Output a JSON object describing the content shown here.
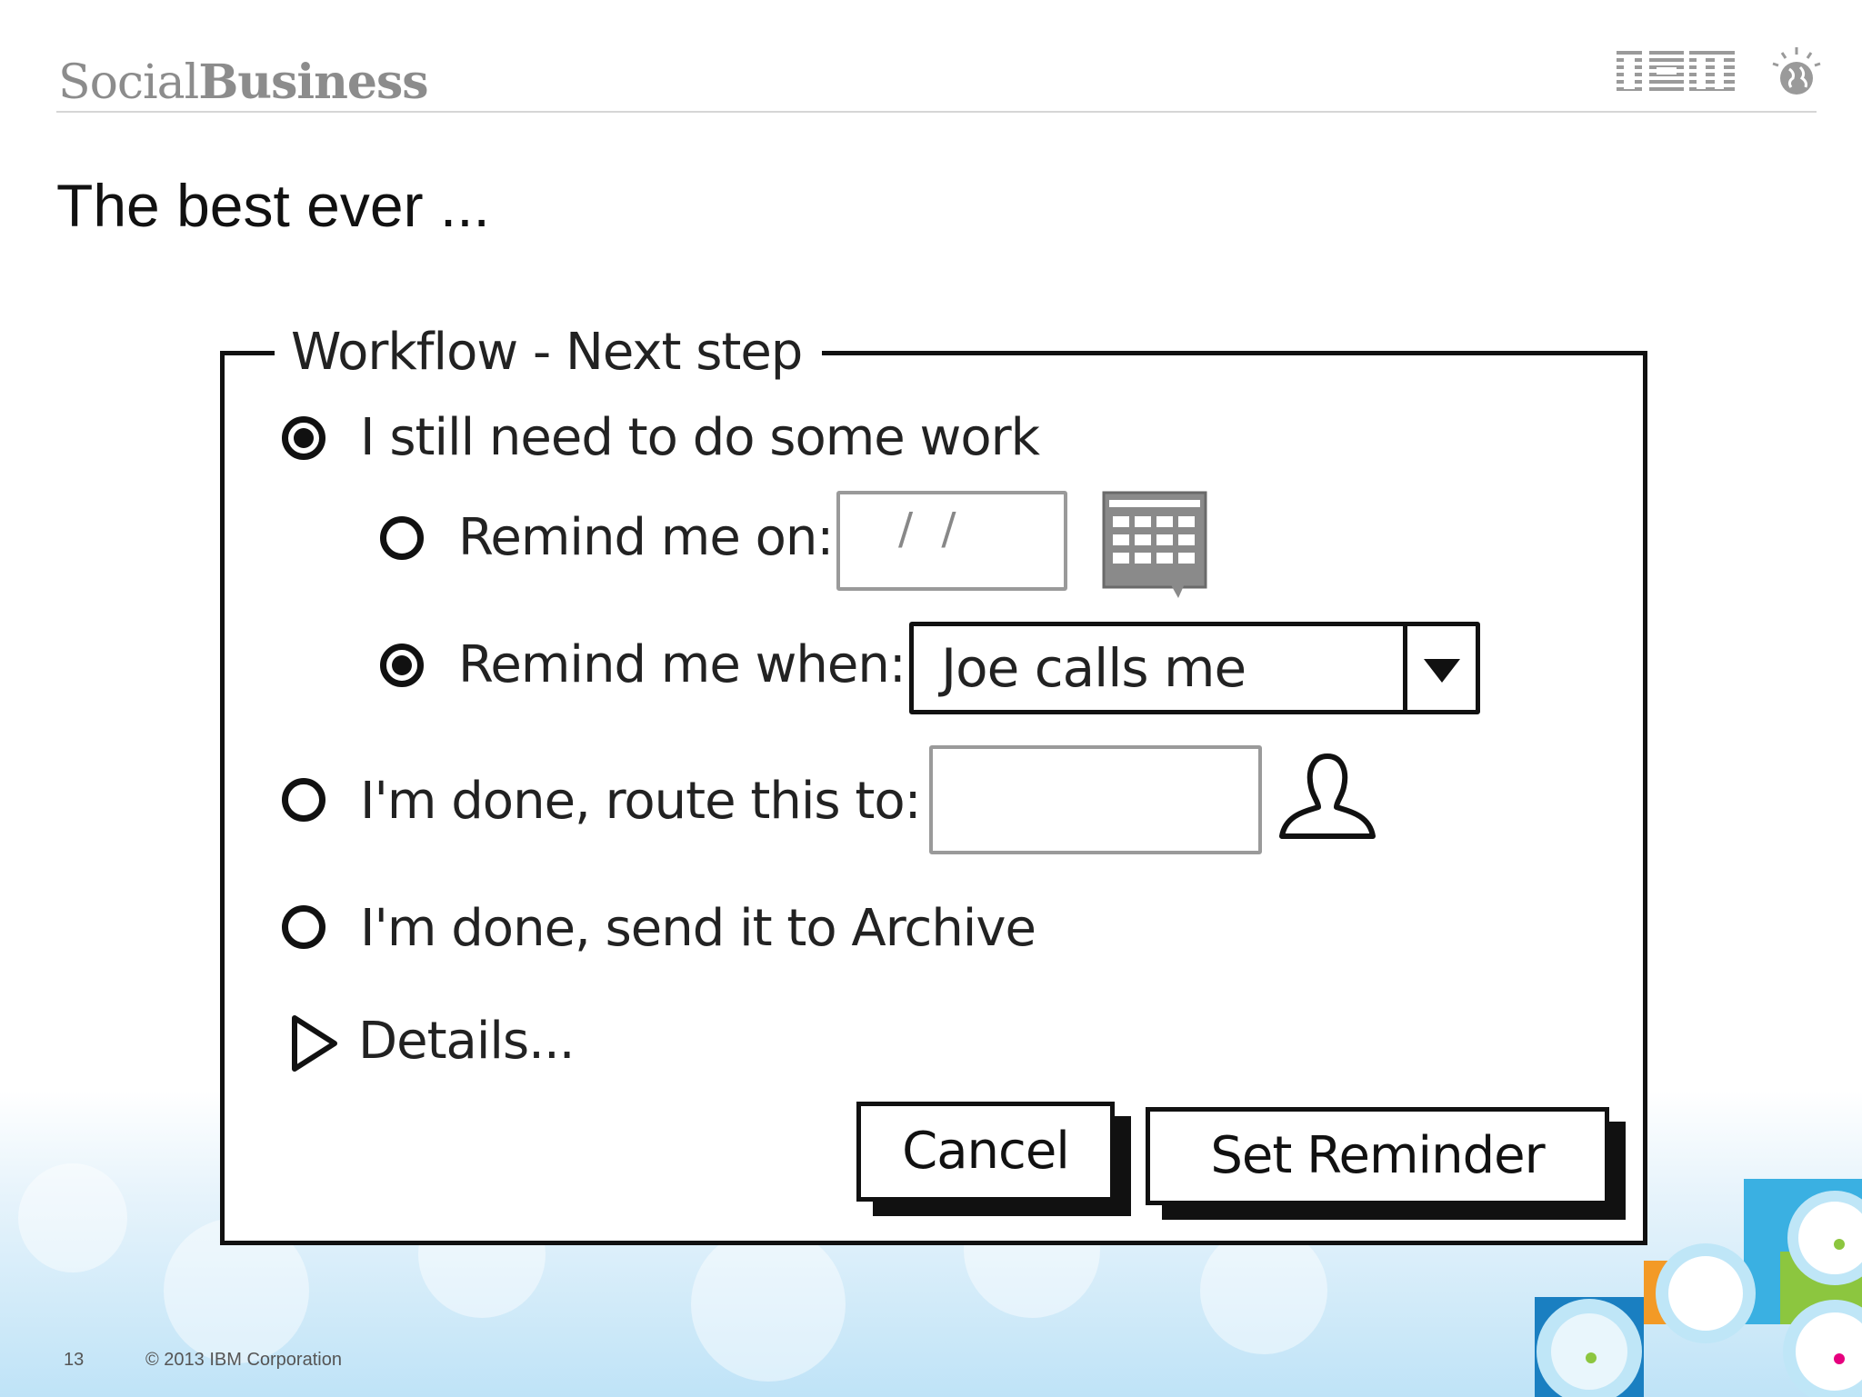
{
  "slide": {
    "brand_word1": "Social",
    "brand_word2": "Business",
    "title": "The best ever ...",
    "page_number": "13",
    "copyright": "© 2013 IBM Corporation",
    "ibm_logo_text": "IBM"
  },
  "dialog": {
    "title": "Workflow - Next step",
    "options": [
      {
        "label": "I still need to do some work",
        "selected": true
      },
      {
        "label": "Remind me on:",
        "selected": false
      },
      {
        "label": "Remind me when:",
        "selected": true
      },
      {
        "label": "I'm done, route this to:",
        "selected": false
      },
      {
        "label": "I'm done, send it to Archive",
        "selected": false
      }
    ],
    "date_field_value": "/ /",
    "route_field_value": "",
    "remind_when_select": "Joe calls me",
    "details_label": "Details...",
    "cancel_label": "Cancel",
    "set_reminder_label": "Set Reminder"
  },
  "colors": {
    "accent_blue": "#3ab0e2",
    "accent_green": "#8cc63f",
    "accent_orange": "#f39a26",
    "accent_magenta": "#e6007e"
  }
}
